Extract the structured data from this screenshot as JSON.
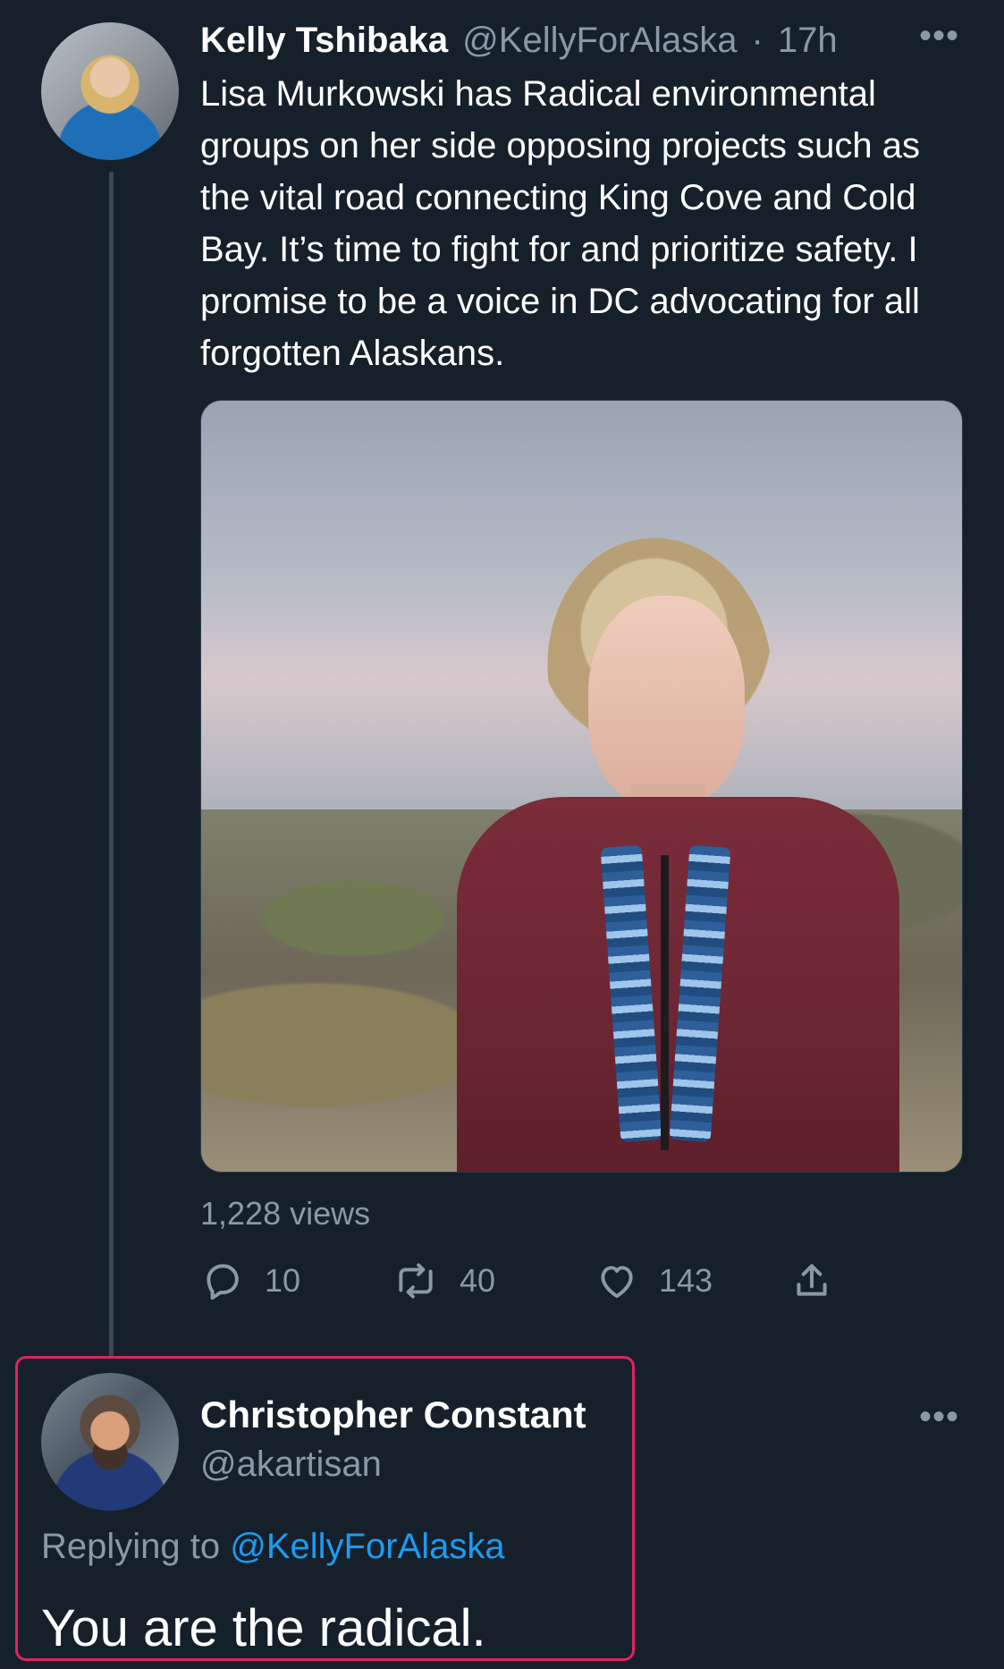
{
  "colors": {
    "background": "#15202b",
    "text": "#ffffff",
    "muted": "#8b98a5",
    "accent": "#1d9bf0",
    "highlight": "#e0245e"
  },
  "tweet": {
    "author_name": "Kelly Tshibaka",
    "author_handle": "@KellyForAlaska",
    "separator": "·",
    "time": "17h",
    "more_label": "•••",
    "text": "Lisa Murkowski has Radical environmental groups on her side opposing projects such as the vital road connecting King Cove and Cold Bay. It’s time to fight for and prioritize safety. I promise to be a voice in DC advocating for all forgotten Alaskans.",
    "views": "1,228 views",
    "stats": {
      "replies": "10",
      "retweets": "40",
      "likes": "143"
    },
    "icons": {
      "reply": "reply-icon",
      "retweet": "retweet-icon",
      "like": "heart-icon",
      "share": "share-icon"
    }
  },
  "reply": {
    "author_name": "Christopher Constant",
    "author_handle": "@akartisan",
    "more_label": "•••",
    "replying_prefix": "Replying to",
    "replying_handle": "@KellyForAlaska",
    "text": "You are the radical."
  }
}
